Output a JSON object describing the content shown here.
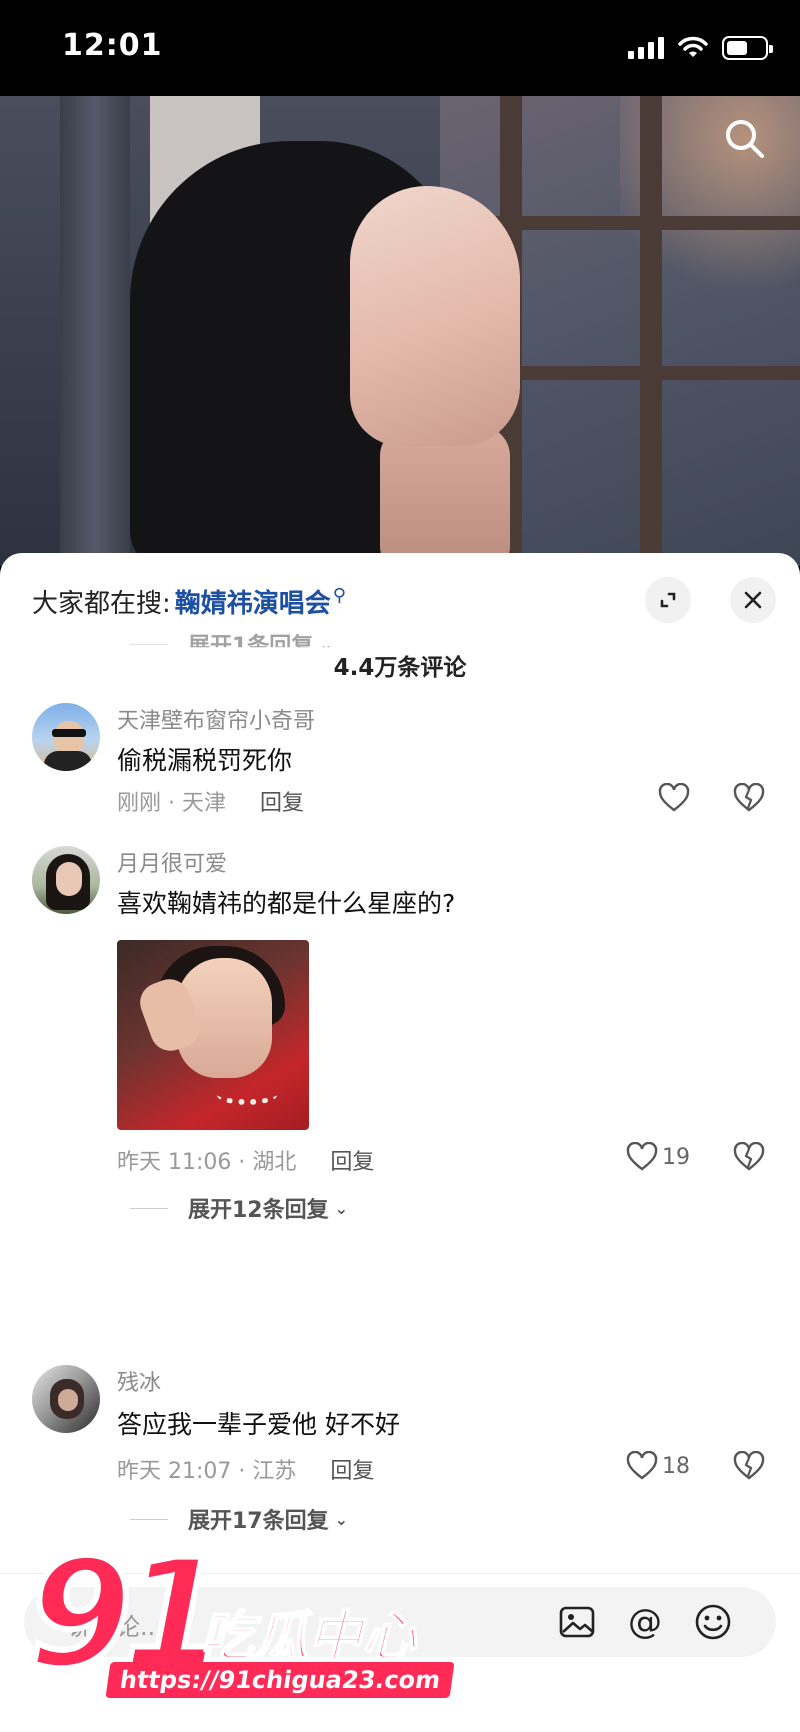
{
  "status_bar": {
    "time": "12:01"
  },
  "hero": {
    "search_icon": "search-icon"
  },
  "sheet": {
    "hot_search_label": "大家都在搜:",
    "hot_search_term": "鞠婧祎演唱会",
    "comment_count": "4.4万条评论",
    "collapsed_top_expander": "展开1条回复",
    "comments": [
      {
        "username": "天津壁布窗帘小奇哥",
        "text": "偷税漏税罚死你",
        "time_location": "刚刚 · 天津",
        "reply_label": "回复",
        "like_count": ""
      },
      {
        "username": "月月很可爱",
        "text": "喜欢鞠婧祎的都是什么星座的?",
        "time_location": "昨天 11:06 · 湖北",
        "reply_label": "回复",
        "like_count": "19",
        "expander": "展开12条回复"
      },
      {
        "username": "残冰",
        "text": "答应我一辈子爱他 好不好",
        "time_location": "昨天 21:07 · 江苏",
        "reply_label": "回复",
        "like_count": "18",
        "expander": "展开17条回复"
      }
    ]
  },
  "input_bar": {
    "placeholder": "说评论..."
  },
  "watermark": {
    "number": "91",
    "name": "吃瓜中心",
    "url": "https://91chigua23.com"
  },
  "colors": {
    "accent_link": "#1d4fa3",
    "watermark": "#ff2a55"
  }
}
